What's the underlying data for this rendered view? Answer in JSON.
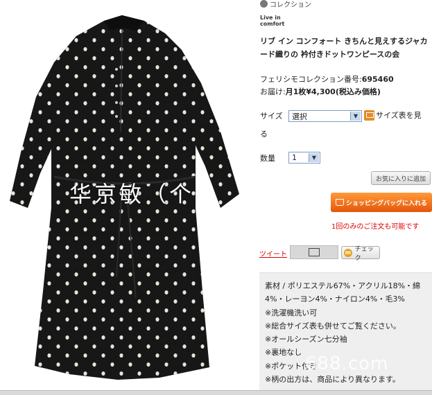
{
  "header": {
    "collection_label": "コレクション",
    "brand_line1": "Live in",
    "brand_line2": "comfort"
  },
  "product": {
    "title": "リブ イン コンフォート きちんと見えするジャカード織りの 衿付きドットワンピースの会",
    "number_label": "フェリシモコレクション番号:",
    "number_value": "695460",
    "price_label": "お届け:",
    "price_value": "月1枚¥4,300(税込み価格)"
  },
  "image": {
    "watermark_text": "华京敏（个",
    "watermark_bottom": "688.com"
  },
  "size": {
    "label": "サイズ",
    "selected": "選択",
    "chart_link": "サイズ表を見",
    "chart_link_wrap": "る",
    "icon": "size-chart-icon"
  },
  "quantity": {
    "label": "数量",
    "selected": "1"
  },
  "actions": {
    "favorite_label": "お気に入りに追加",
    "cart_label": "ショッピングバッグに入れる",
    "order_note": "1回のみのご注文も可能です",
    "tweet_label": "ツイート",
    "check_label": "チェック"
  },
  "specs": [
    "素材 / ポリエステル67%・アクリル18%・綿",
    "4%・レーヨン4%・ナイロン4%・毛3%",
    "※洗濯機洗い可",
    "※総合サイズ表も併せてご覧ください。",
    "※オールシーズン七分袖",
    "※裏地なし",
    "※ポケット付き",
    "※柄の出方は、商品により異なります。"
  ],
  "colors": {
    "cart_button": "#f07020",
    "note_red": "#e00000",
    "spec_bg": "#efefef"
  }
}
